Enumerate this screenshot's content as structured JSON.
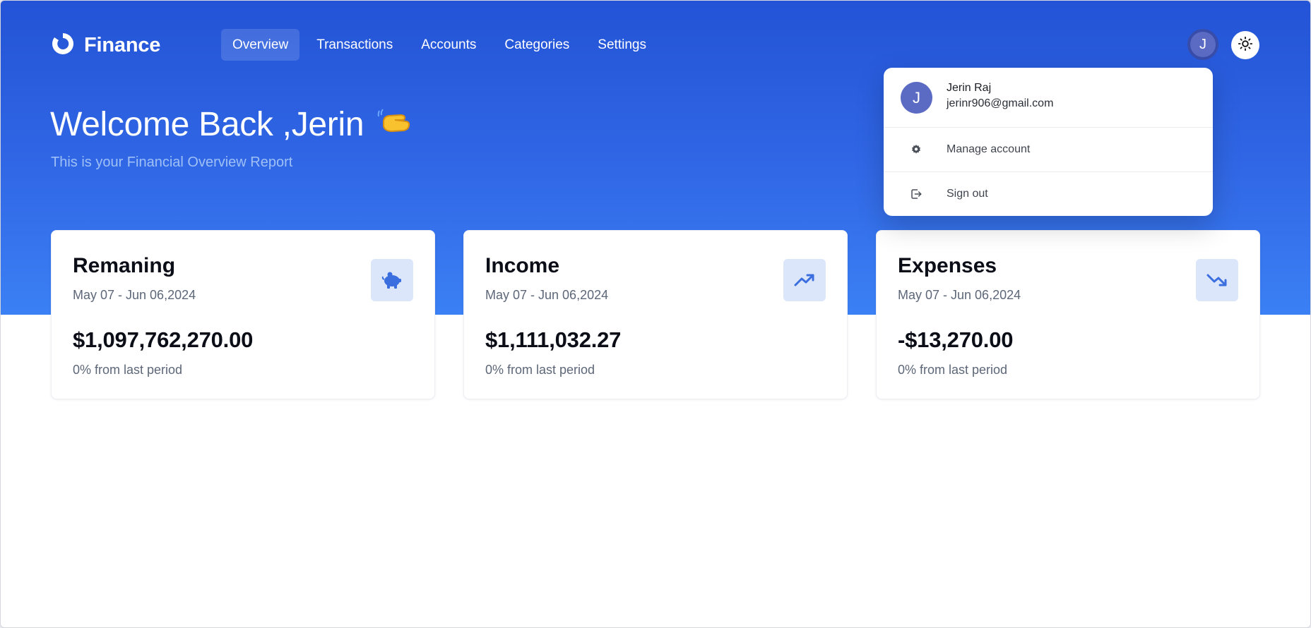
{
  "header": {
    "logo_text": "Finance",
    "nav": [
      {
        "label": "Overview",
        "active": true
      },
      {
        "label": "Transactions",
        "active": false
      },
      {
        "label": "Accounts",
        "active": false
      },
      {
        "label": "Categories",
        "active": false
      },
      {
        "label": "Settings",
        "active": false
      }
    ],
    "avatar_initial": "J"
  },
  "welcome": {
    "title": "Welcome Back ,Jerin",
    "emoji": "👋",
    "subtitle": "This is your Financial Overview Report"
  },
  "cards": [
    {
      "title": "Remaning",
      "range": "May 07 - Jun 06,2024",
      "amount": "$1,097,762,270.00",
      "change": "0% from last period",
      "icon": "piggy-bank-icon"
    },
    {
      "title": "Income",
      "range": "May 07 - Jun 06,2024",
      "amount": "$1,111,032.27",
      "change": "0% from last period",
      "icon": "trending-up-icon"
    },
    {
      "title": "Expenses",
      "range": "May 07 - Jun 06,2024",
      "amount": "-$13,270.00",
      "change": "0% from last period",
      "icon": "trending-down-icon"
    }
  ],
  "user_menu": {
    "initial": "J",
    "name": "Jerin Raj",
    "email": "jerinr906@gmail.com",
    "items": [
      {
        "label": "Manage account",
        "icon": "gear-icon"
      },
      {
        "label": "Sign out",
        "icon": "sign-out-icon"
      }
    ]
  },
  "colors": {
    "accent": "#2353d6",
    "hero_bottom": "#3b80f4",
    "icon_bg": "#dbe6fb",
    "icon_fg": "#3b6fe0",
    "avatar": "#5b6bc4"
  }
}
